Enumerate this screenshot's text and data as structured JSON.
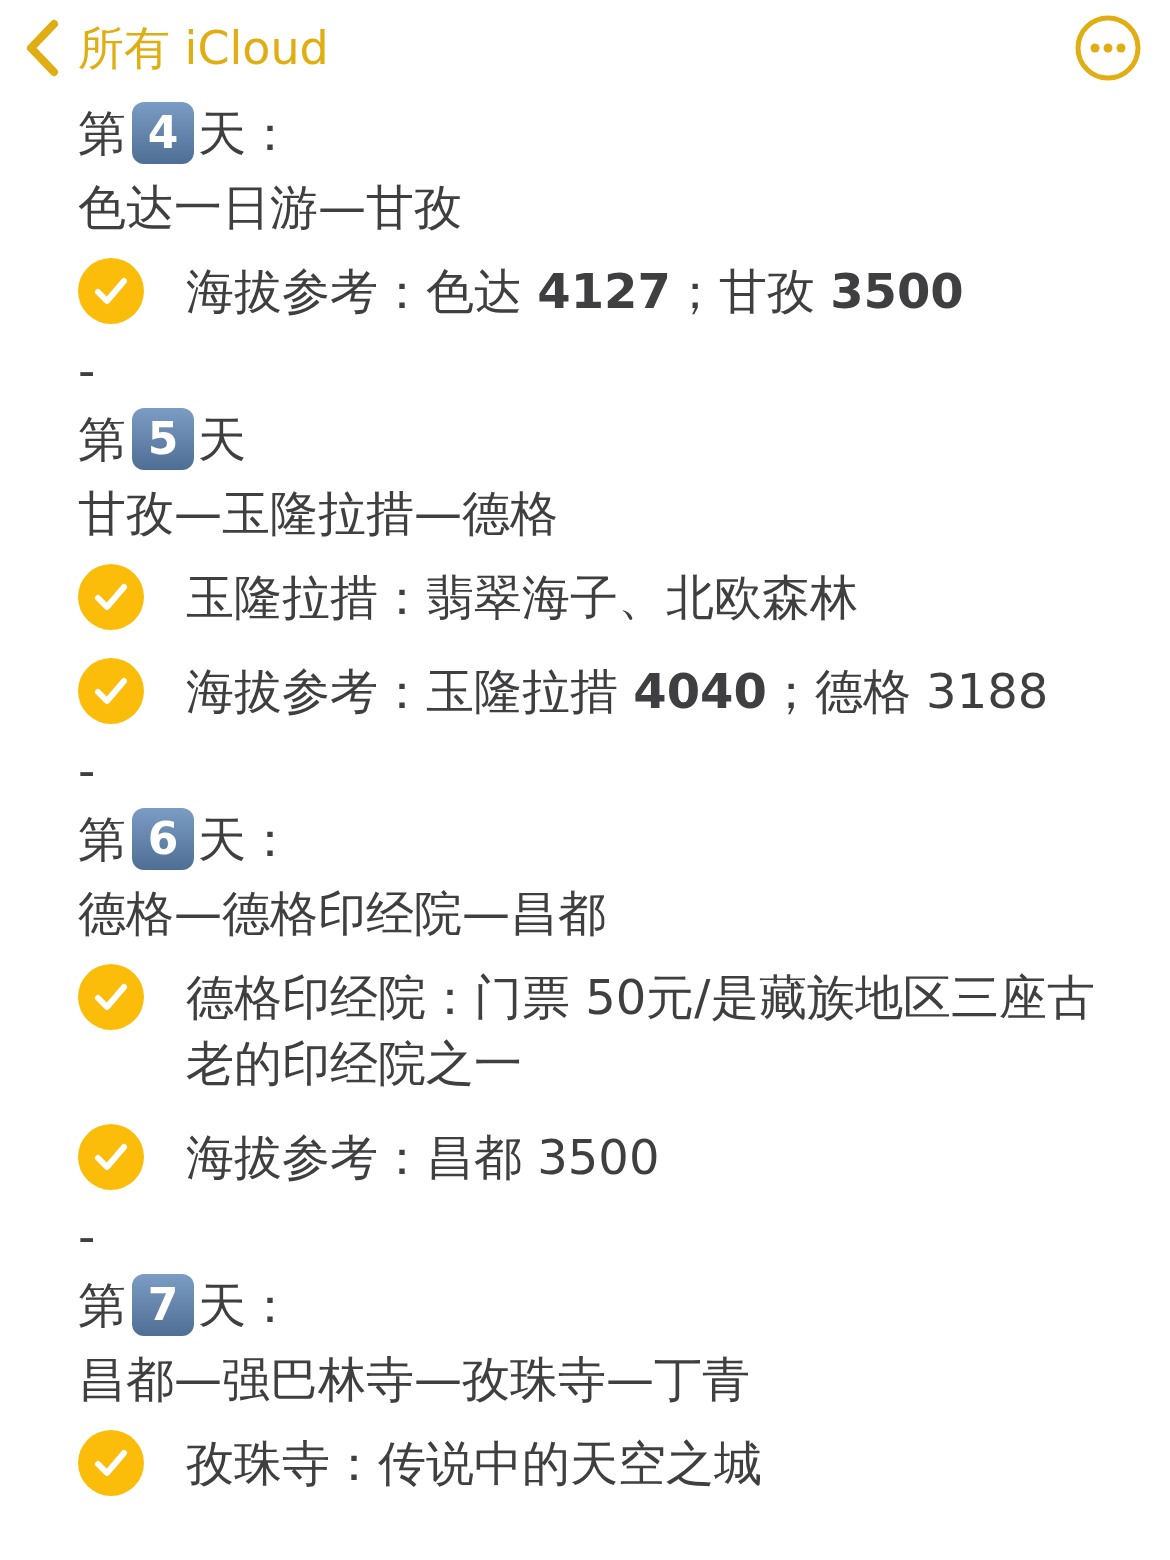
{
  "nav": {
    "back_label": "所有 iCloud"
  },
  "lines": [
    {
      "kind": "day",
      "prefix": "第",
      "number": "4",
      "suffix": "天："
    },
    {
      "kind": "route",
      "text": "色达一日游—甘孜"
    },
    {
      "kind": "check",
      "checked": true,
      "text": "海拔参考：色达 **4127**；甘孜 **3500**"
    },
    {
      "kind": "dash",
      "text": "-"
    },
    {
      "kind": "day",
      "prefix": "第",
      "number": "5",
      "suffix": "天"
    },
    {
      "kind": "route",
      "text": "甘孜—玉隆拉措—德格"
    },
    {
      "kind": "check",
      "checked": true,
      "text": "玉隆拉措：翡翠海子、北欧森林"
    },
    {
      "kind": "check",
      "checked": true,
      "text": "海拔参考：玉隆拉措 **4040**；德格 3188"
    },
    {
      "kind": "dash",
      "text": "-"
    },
    {
      "kind": "day",
      "prefix": "第",
      "number": "6",
      "suffix": "天："
    },
    {
      "kind": "route",
      "text": "德格—德格印经院—昌都"
    },
    {
      "kind": "check",
      "checked": true,
      "text": "德格印经院：门票 50元/是藏族地区三座古老的印经院之一"
    },
    {
      "kind": "check",
      "checked": true,
      "text": "海拔参考：昌都 3500"
    },
    {
      "kind": "dash",
      "text": "-"
    },
    {
      "kind": "day",
      "prefix": "第",
      "number": "7",
      "suffix": "天："
    },
    {
      "kind": "route",
      "text": "昌都—强巴林寺—孜珠寺—丁青"
    },
    {
      "kind": "check",
      "checked": true,
      "text": "孜珠寺：传说中的天空之城"
    }
  ]
}
